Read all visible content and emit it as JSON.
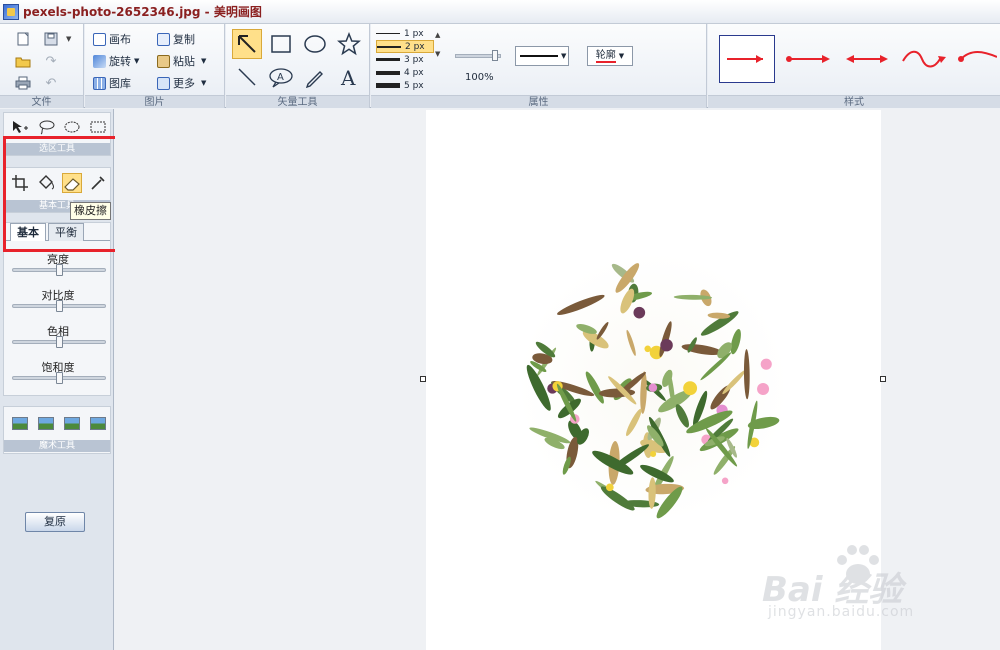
{
  "window": {
    "title": "pexels-photo-2652346.jpg - 美明画图"
  },
  "ribbon": {
    "groups": {
      "file": "文件",
      "image": "图片",
      "vector": "矢量工具",
      "props": "属性",
      "style": "样式"
    },
    "image_buttons": {
      "canvas": "画布",
      "rotate": "旋转",
      "gallery": "图库",
      "copy": "复制",
      "paste": "粘贴",
      "more": "更多"
    },
    "line_widths": [
      "1 px",
      "2 px",
      "3 px",
      "4 px",
      "5 px"
    ],
    "selected_line_width": "2 px",
    "zoom": "100%",
    "outline_label": "轮廓",
    "colors": {
      "accent_red": "#e8222b",
      "selection_yellow": "#ffe08a",
      "style_arrow": "#e8222b"
    }
  },
  "left_panel": {
    "select_tools_title": "选区工具",
    "basic_tools_title": "基本工具",
    "tooltip": "橡皮擦",
    "tabs": [
      "基本",
      "平衡"
    ],
    "active_tab": "基本",
    "sliders": [
      {
        "label": "亮度",
        "value": 0.5
      },
      {
        "label": "对比度",
        "value": 0.5
      },
      {
        "label": "色相",
        "value": 0.5
      },
      {
        "label": "饱和度",
        "value": 0.5
      }
    ],
    "magic_title": "魔术工具",
    "restore_button": "复原"
  },
  "watermark": {
    "brand": "Bai 经验",
    "url": "jingyan.baidu.com"
  }
}
